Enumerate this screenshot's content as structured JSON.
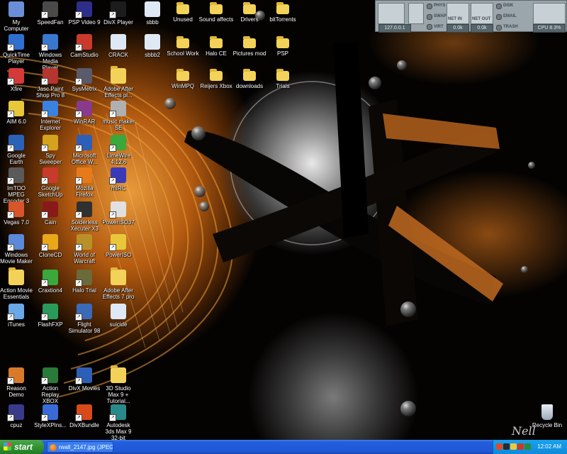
{
  "desktop_icons": [
    {
      "label": "My Computer",
      "color": "#6a8fd8",
      "shortcut": false
    },
    {
      "label": "SpeedFan",
      "color": "#4a4a4a",
      "shortcut": true
    },
    {
      "label": "PSP Video 9",
      "color": "#2e2e8a",
      "shortcut": true
    },
    {
      "label": "DivX Player",
      "color": "#1c1c1c",
      "shortcut": true
    },
    {
      "label": "sbbb",
      "color": "#dfe9f5",
      "shortcut": false
    },
    {
      "label": "QuickTime Player",
      "color": "#2f6fd0",
      "shortcut": true
    },
    {
      "label": "Windows Media Player",
      "color": "#3a78d0",
      "shortcut": true
    },
    {
      "label": "CamStudio",
      "color": "#c93a2a",
      "shortcut": true
    },
    {
      "label": "CRACK",
      "color": "#dfe9f5",
      "shortcut": false
    },
    {
      "label": "sbbb2",
      "color": "#dfe9f5",
      "shortcut": false
    },
    {
      "label": "Xfire",
      "color": "#d43a3a",
      "shortcut": true
    },
    {
      "label": "Jasc Paint Shop Pro 8",
      "color": "#b7352f",
      "shortcut": true
    },
    {
      "label": "SysMetrix",
      "color": "#5a5a6a",
      "shortcut": true
    },
    {
      "label": "Adobe After Effects pl...",
      "color": "#f3d25a",
      "shortcut": false
    },
    {
      "label": "AIM 6.0",
      "color": "#e8c83a",
      "shortcut": true
    },
    {
      "label": "Internet Explorer",
      "color": "#3a82e0",
      "shortcut": true
    },
    {
      "label": "WinRAR",
      "color": "#8a3a8a",
      "shortcut": true
    },
    {
      "label": "music maker SE",
      "color": "#b0b0b0",
      "shortcut": true
    },
    {
      "label": "Google Earth",
      "color": "#2a62b8",
      "shortcut": true
    },
    {
      "label": "Spy Sweeper",
      "color": "#d4a21c",
      "shortcut": true
    },
    {
      "label": "Microsoft Office W...",
      "color": "#2e5fb7",
      "shortcut": true
    },
    {
      "label": "LimeWire 4.12.6",
      "color": "#3aa83a",
      "shortcut": true
    },
    {
      "label": "ImTOO MPEG Encoder 3",
      "color": "#5a5a5a",
      "shortcut": true
    },
    {
      "label": "Google SketchUp",
      "color": "#c83a2a",
      "shortcut": true
    },
    {
      "label": "Mozilla Firefox",
      "color": "#e67a1a",
      "shortcut": true
    },
    {
      "label": "mIRC",
      "color": "#3a3ab8",
      "shortcut": true
    },
    {
      "label": "Vegas 7.0",
      "color": "#d8542a",
      "shortcut": true
    },
    {
      "label": "Cain",
      "color": "#8a1a1a",
      "shortcut": true
    },
    {
      "label": "Solderless Xecuter X3 ...",
      "color": "#303030",
      "shortcut": true
    },
    {
      "label": "PowerISO37",
      "color": "#e0e0e0",
      "shortcut": true
    },
    {
      "label": "Windows Movie Maker",
      "color": "#5a8ad8",
      "shortcut": true
    },
    {
      "label": "CloneCD",
      "color": "#e8a81a",
      "shortcut": true
    },
    {
      "label": "World of Warcraft",
      "color": "#b8902a",
      "shortcut": true
    },
    {
      "label": "PowerISO",
      "color": "#e8c83a",
      "shortcut": true
    },
    {
      "label": "Action Movie Essentials",
      "color": "#f3d25a",
      "shortcut": false
    },
    {
      "label": "Craxtion4",
      "color": "#3aa83a",
      "shortcut": true
    },
    {
      "label": "Halo Trial",
      "color": "#6a6a3a",
      "shortcut": true
    },
    {
      "label": "Adobe After Effects 7 pro",
      "color": "#f3d25a",
      "shortcut": false
    },
    {
      "label": "iTunes",
      "color": "#6aa8e8",
      "shortcut": true
    },
    {
      "label": "FlashFXP",
      "color": "#2a9a5a",
      "shortcut": true
    },
    {
      "label": "Flight Simulator 98",
      "color": "#3a6ab8",
      "shortcut": true
    },
    {
      "label": "suicide",
      "color": "#dfe9f5",
      "shortcut": false
    },
    {
      "label": "Reason Demo",
      "color": "#d87a2a",
      "shortcut": true
    },
    {
      "label": "Action Replay XBOX",
      "color": "#2a7a3a",
      "shortcut": true
    },
    {
      "label": "DivX Movies",
      "color": "#2e5fb7",
      "shortcut": true
    },
    {
      "label": "3D Studio Max 9 + Tutorial...",
      "color": "#f3d25a",
      "shortcut": false
    },
    {
      "label": "cpuz",
      "color": "#3a3a8a",
      "shortcut": true
    },
    {
      "label": "StyleXPIns...",
      "color": "#3a6ad8",
      "shortcut": true
    },
    {
      "label": "DivXBundle",
      "color": "#d84a1a",
      "shortcut": true
    },
    {
      "label": "Autodesk 3ds Max 9 32-bit",
      "color": "#2a8a8a",
      "shortcut": true
    }
  ],
  "folders": [
    {
      "label": "Unused"
    },
    {
      "label": "Sound affects"
    },
    {
      "label": "Drivers"
    },
    {
      "label": "bitTorrents"
    },
    {
      "label": "School Work"
    },
    {
      "label": "Halo CE"
    },
    {
      "label": "Pictures mod"
    },
    {
      "label": "PSP"
    },
    {
      "label": "WinMPQ"
    },
    {
      "label": "Reijers Xbox"
    },
    {
      "label": "downloads"
    },
    {
      "label": "Trials"
    }
  ],
  "recycle_bin": {
    "label": "Recycle Bin"
  },
  "sysmetrix": {
    "ip": "127.0.0.1",
    "phys": "PHYS",
    "swap": "SWAP",
    "virt": "VIRT",
    "net_in": "NET IN",
    "net_out": "NET OUT",
    "net_in_value": "0.0k",
    "net_out_value": "0.0k",
    "disk": "DISK",
    "email": "EMAIL",
    "trash": "TRASH",
    "cpu": "CPU 8.3%"
  },
  "taskbar": {
    "start_label": "start",
    "task_label": "rwall_2147.jpg (JPEG...",
    "clock": "12:02 AM"
  },
  "wallpaper": {
    "signature": "Nell"
  }
}
